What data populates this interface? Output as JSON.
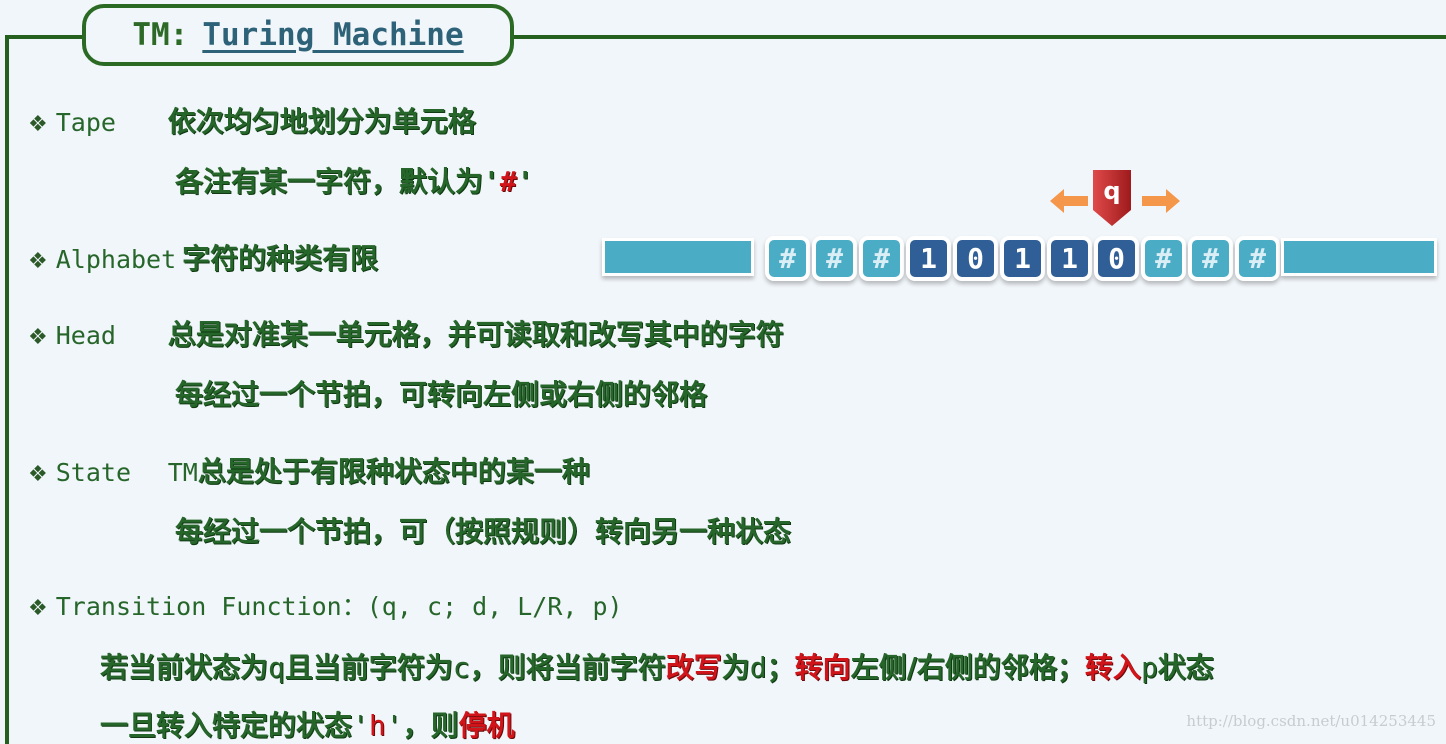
{
  "title": {
    "prefix": "TM:",
    "main": "Turing Machine"
  },
  "colors": {
    "frame": "#25601f",
    "text_green": "#26662a",
    "highlight_red": "#d0141a",
    "tape_blank": "#4bacc6",
    "tape_symbol": "#2f5f96",
    "head": "#c0282a",
    "arrow": "#f4974a"
  },
  "sections": {
    "tape": {
      "term": "Tape",
      "line1": "依次均匀地划分为单元格",
      "line2_pre": "各注有某一字符，默认为",
      "line2_q1": "'",
      "line2_sym": "#",
      "line2_q2": "'"
    },
    "alphabet": {
      "term": "Alphabet",
      "line1": "字符的种类有限"
    },
    "head": {
      "term": "Head",
      "line1": "总是对准某一单元格，并可读取和改写其中的字符",
      "line2": "每经过一个节拍，可转向左侧或右侧的邻格"
    },
    "state": {
      "term": "State",
      "line1_prefix": "TM",
      "line1": "总是处于有限种状态中的某一种",
      "line2": "每经过一个节拍，可（按照规则）转向另一种状态"
    },
    "transition": {
      "term": "Transition Function",
      "colon": "：",
      "signature": "(q, c; d, L/R, p)",
      "line1": [
        {
          "text": "若当前状态为",
          "red": false
        },
        {
          "text": "q",
          "red": false,
          "mono": true
        },
        {
          "text": "且当前字符为",
          "red": false
        },
        {
          "text": "c",
          "red": false,
          "mono": true
        },
        {
          "text": "，则将当前字符",
          "red": false
        },
        {
          "text": "改写",
          "red": true
        },
        {
          "text": "为",
          "red": false
        },
        {
          "text": "d",
          "red": false,
          "mono": true
        },
        {
          "text": "；",
          "red": false
        },
        {
          "text": "转向",
          "red": true
        },
        {
          "text": "左侧/右侧的邻格；",
          "red": false
        },
        {
          "text": "转入",
          "red": true
        },
        {
          "text": "p",
          "red": false,
          "mono": true
        },
        {
          "text": "状态",
          "red": false
        }
      ],
      "line2": [
        {
          "text": "一旦转入特定的状态",
          "red": false
        },
        {
          "text": "'",
          "red": false,
          "mono": true
        },
        {
          "text": "h",
          "red": true,
          "mono": true
        },
        {
          "text": "'",
          "red": false,
          "mono": true
        },
        {
          "text": "，则",
          "red": false
        },
        {
          "text": "停机",
          "red": true
        }
      ]
    }
  },
  "tape": {
    "cells": [
      "#",
      "#",
      "#",
      "1",
      "0",
      "1",
      "1",
      "0",
      "#",
      "#",
      "#"
    ],
    "head_state": "q",
    "head_index": 7,
    "left_arrow": "left-arrow",
    "right_arrow": "right-arrow"
  },
  "bullet_glyph": "❖",
  "watermark": "http://blog.csdn.net/u014253445"
}
